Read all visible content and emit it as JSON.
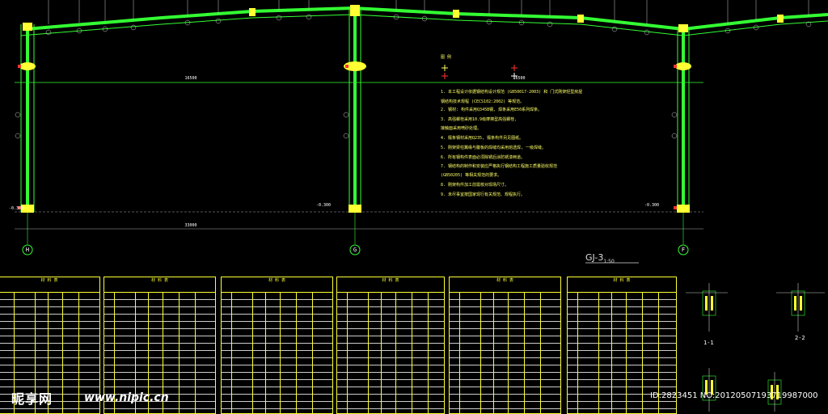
{
  "drawing": {
    "title_main": "GJ-3",
    "title_scale": "1:50",
    "axes": [
      "H",
      "G",
      "F"
    ],
    "dimensions": {
      "span_left": "16500",
      "span_right": "16500",
      "total": "33000"
    },
    "levels": {
      "left": "-0.300",
      "mid": "-0.300",
      "right": "-0.300"
    }
  },
  "notes": {
    "legend_title": "图 例",
    "items": [
      "1. 本工程设计依据钢结构设计规范 (GB50017-2003) 和 门式刚架轻型房屋",
      "   钢结构技术规程 (CECS102:2002) 等规范。",
      "2. 钢材: 构件采用Q345B钢, 焊条采用E50系列焊条。",
      "3. 高强螺栓采用10.9级摩擦型高强螺栓,",
      "   接触面采用喷砂处理。",
      "4. 檩条钢材采用Q235, 檩条构件另见图纸。",
      "5. 刚架梁柱翼缘与腹板的焊缝均采用熔透焊, 一级焊缝。",
      "6. 所有钢构件表面必须除锈后涂防锈漆两道。",
      "7. 钢结构的制作和安装应严格执行钢结构工程施工质量验收规范",
      "   (GB50205) 等相关规范的要求。",
      "8. 刚架构件加工前需核对现场尺寸。",
      "9. 未尽事宜按国家现行有关规范、规程执行。"
    ]
  },
  "tables": {
    "header_title": "材 料 表",
    "count": 6
  },
  "sections": {
    "s1": "1-1",
    "s2": "2-2"
  },
  "watermark": {
    "brand": "昵享网",
    "url": "www.nipic.cn",
    "id": "ID:2823451 NO:20120507193719987000"
  }
}
